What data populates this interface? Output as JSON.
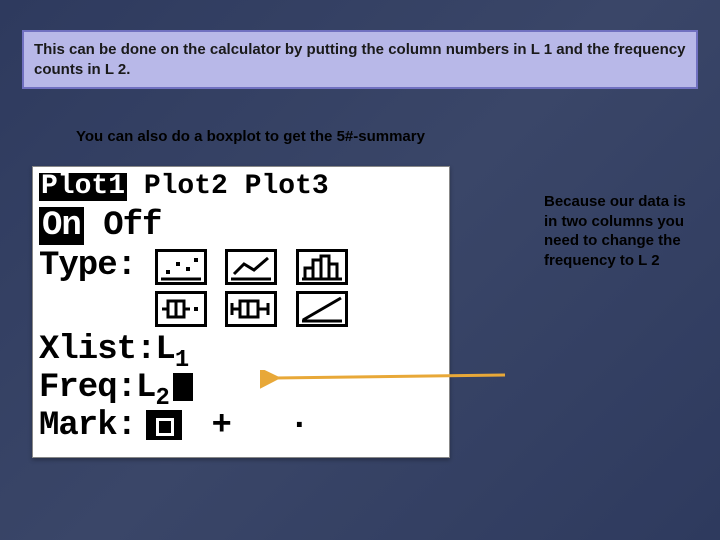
{
  "banner_text": "This can be done on the calculator by putting the column numbers in L 1  and the frequency counts in L 2.",
  "subtitle": "You can also do a boxplot to get the 5#-summary",
  "calc": {
    "tab1": "Plot1",
    "tab2": "Plot2",
    "tab3": "Plot3",
    "on": "On",
    "off": "Off",
    "type_label": "Type:",
    "xlist_label": "Xlist:",
    "xlist_value": "L₁",
    "freq_label": "Freq:",
    "freq_value": "L₂",
    "mark_label": "Mark:",
    "mark_plus": "+",
    "mark_dot": "·"
  },
  "side_note": "Because our data is in two columns you need to change the frequency to L 2",
  "icons": {
    "scatter": "scatter-plot-icon",
    "line": "line-plot-icon",
    "histogram": "histogram-icon",
    "boxplot_outlier": "boxplot-outlier-icon",
    "boxplot": "boxplot-icon",
    "normal": "normal-prob-icon"
  }
}
